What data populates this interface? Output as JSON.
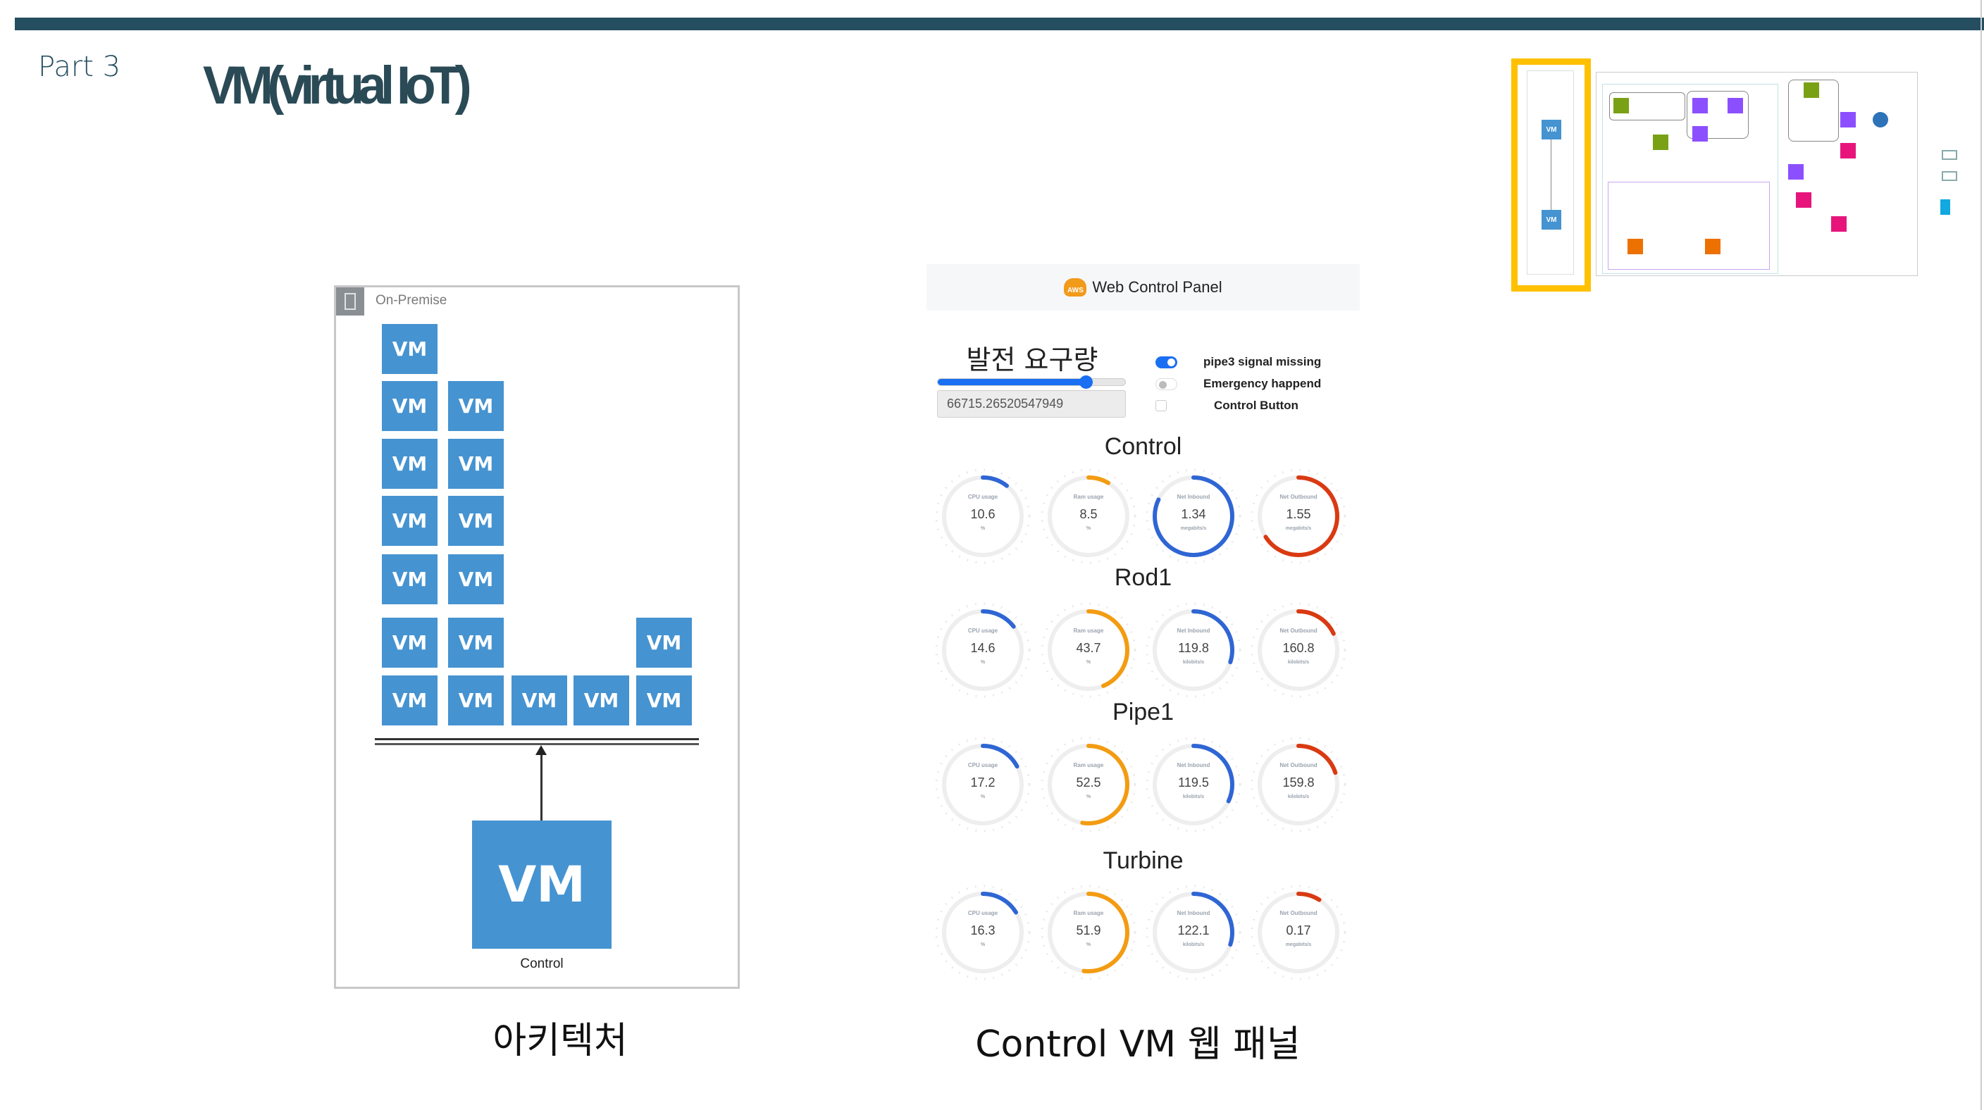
{
  "slide": {
    "part": "Part 3",
    "title": "VM(virtual IoT)"
  },
  "diagram": {
    "group_label": "On-Premise",
    "vm_label": "VM",
    "control_label": "Control",
    "caption": "아키텍처"
  },
  "panel": {
    "header_icon": "aws-cloud-icon",
    "header_icon_text": "AWS",
    "title": "Web Control Panel",
    "demand_label": "발전 요구량",
    "demand_slider_fraction": 0.79,
    "demand_value": "66715.26520547949",
    "options": [
      {
        "label": "pipe3 signal missing",
        "type": "toggle",
        "on": true
      },
      {
        "label": "Emergency happend",
        "type": "toggle",
        "on": false
      },
      {
        "label": "Control Button",
        "type": "checkbox",
        "checked": false
      }
    ],
    "caption": "Control VM 웹 패널",
    "colors": {
      "cpu": "#2f66d4",
      "ram": "#f39c12",
      "inbound": "#2f66d4",
      "outbound": "#d93a12",
      "track": "#eeeeee"
    },
    "sections": [
      {
        "name": "Control",
        "gauges": [
          {
            "label": "CPU usage",
            "value": "10.6",
            "unit": "%",
            "fraction": 0.106
          },
          {
            "label": "Ram usage",
            "value": "8.5",
            "unit": "%",
            "fraction": 0.085
          },
          {
            "label": "Net Inbound",
            "value": "1.34",
            "unit": "megabits/s",
            "fraction": 0.82
          },
          {
            "label": "Net Outbound",
            "value": "1.55",
            "unit": "megabits/s",
            "fraction": 0.66
          }
        ]
      },
      {
        "name": "Rod1",
        "gauges": [
          {
            "label": "CPU usage",
            "value": "14.6",
            "unit": "%",
            "fraction": 0.146
          },
          {
            "label": "Ram usage",
            "value": "43.7",
            "unit": "%",
            "fraction": 0.437
          },
          {
            "label": "Net Inbound",
            "value": "119.8",
            "unit": "kilobits/s",
            "fraction": 0.3
          },
          {
            "label": "Net Outbound",
            "value": "160.8",
            "unit": "kilobits/s",
            "fraction": 0.18
          }
        ]
      },
      {
        "name": "Pipe1",
        "gauges": [
          {
            "label": "CPU usage",
            "value": "17.2",
            "unit": "%",
            "fraction": 0.172
          },
          {
            "label": "Ram usage",
            "value": "52.5",
            "unit": "%",
            "fraction": 0.525
          },
          {
            "label": "Net Inbound",
            "value": "119.5",
            "unit": "kilobits/s",
            "fraction": 0.32
          },
          {
            "label": "Net Outbound",
            "value": "159.8",
            "unit": "kilobits/s",
            "fraction": 0.2
          }
        ]
      },
      {
        "name": "Turbine",
        "gauges": [
          {
            "label": "CPU usage",
            "value": "16.3",
            "unit": "%",
            "fraction": 0.163
          },
          {
            "label": "Ram usage",
            "value": "51.9",
            "unit": "%",
            "fraction": 0.519
          },
          {
            "label": "Net Inbound",
            "value": "122.1",
            "unit": "kilobits/s",
            "fraction": 0.3
          },
          {
            "label": "Net Outbound",
            "value": "0.17",
            "unit": "megabits/s",
            "fraction": 0.09
          }
        ]
      }
    ]
  },
  "thumbnail": {
    "highlight_color": "#ffc000",
    "vm_label": "VM"
  }
}
